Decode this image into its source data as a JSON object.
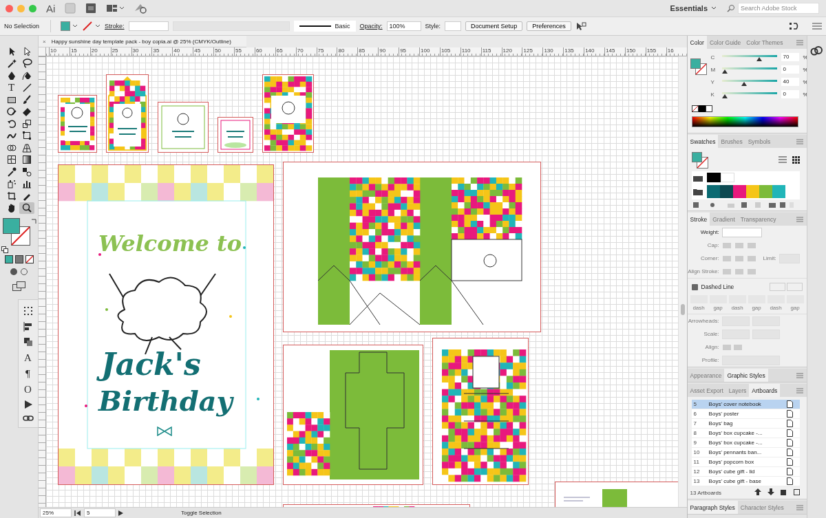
{
  "app_bar": {
    "app_label": "Ai",
    "workspace": "Essentials",
    "search": {
      "placeholder": "Search Adobe Stock"
    }
  },
  "control_bar": {
    "selection": "No Selection",
    "stroke_label": "Stroke:",
    "brush": "Basic",
    "opacity_label": "Opacity:",
    "opacity": "100%",
    "style_label": "Style:",
    "buttons": [
      "Document Setup",
      "Preferences"
    ]
  },
  "document_tab": {
    "close": "×",
    "title": "Happy sunshine day template pack - boy copia.ai @ 25% (CMYK/Outline)"
  },
  "ruler": {
    "labels": [
      "10",
      "15",
      "20",
      "25",
      "30",
      "35",
      "40",
      "45",
      "50",
      "55",
      "60",
      "65",
      "70",
      "75",
      "80",
      "85",
      "90",
      "95",
      "100",
      "105",
      "110",
      "115",
      "120",
      "125",
      "130",
      "135",
      "140",
      "145",
      "150",
      "155",
      "16"
    ]
  },
  "tools": [
    {
      "kind": "selection",
      "selected": false
    },
    {
      "kind": "direct",
      "selected": false
    },
    {
      "kind": "wand",
      "selected": false
    },
    {
      "kind": "lasso",
      "selected": false
    },
    {
      "kind": "pen",
      "selected": false
    },
    {
      "kind": "curvature",
      "selected": false
    },
    {
      "kind": "type",
      "glyph": "T",
      "selected": false
    },
    {
      "kind": "line",
      "selected": false
    },
    {
      "kind": "rectangle",
      "selected": false
    },
    {
      "kind": "brush",
      "selected": false
    },
    {
      "kind": "shaper",
      "selected": false
    },
    {
      "kind": "eraser",
      "selected": false
    },
    {
      "kind": "rotate",
      "selected": false
    },
    {
      "kind": "scale",
      "selected": false
    },
    {
      "kind": "warp",
      "selected": false
    },
    {
      "kind": "transform",
      "selected": false
    },
    {
      "kind": "shape-builder",
      "selected": false
    },
    {
      "kind": "perspective",
      "selected": false
    },
    {
      "kind": "mesh",
      "selected": false
    },
    {
      "kind": "gradient",
      "selected": false
    },
    {
      "kind": "eyedropper",
      "selected": false
    },
    {
      "kind": "blend",
      "selected": false
    },
    {
      "kind": "sprayer",
      "selected": false
    },
    {
      "kind": "graph",
      "selected": false
    },
    {
      "kind": "artboard",
      "selected": false
    },
    {
      "kind": "pencil",
      "selected": false
    },
    {
      "kind": "hand",
      "selected": false
    },
    {
      "kind": "zoom",
      "selected": true
    }
  ],
  "floating_panel": {
    "glyphs": [
      "A",
      "¶",
      "O"
    ]
  },
  "artwork": {
    "welcome": "Welcome to",
    "name": "Jack's",
    "occasion": "Birthday"
  },
  "status_bar": {
    "zoom": "25%",
    "artboard": "5",
    "action": "Toggle Selection"
  },
  "color_panel": {
    "tabs": [
      {
        "label": "Color",
        "selected": true
      },
      {
        "label": "Color Guide",
        "selected": false
      },
      {
        "label": "Color Themes",
        "selected": false
      }
    ],
    "channels": [
      {
        "name": "C",
        "level": 0.7,
        "value": "70",
        "unit": "%"
      },
      {
        "name": "M",
        "level": 0,
        "value": "0",
        "unit": "%"
      },
      {
        "name": "Y",
        "level": 0.4,
        "value": "40",
        "unit": "%"
      },
      {
        "name": "K",
        "level": 0,
        "value": "0",
        "unit": "%"
      }
    ]
  },
  "swatches_panel": {
    "tabs": [
      {
        "label": "Swatches",
        "selected": true
      },
      {
        "label": "Brushes",
        "selected": false
      },
      {
        "label": "Symbols",
        "selected": false
      }
    ],
    "swatches": [
      {
        "color": "#0b6b73"
      },
      {
        "color": "#0d4a52"
      },
      {
        "color": "#e8197d"
      },
      {
        "color": "#f5c518"
      },
      {
        "color": "#7cbb3a"
      },
      {
        "color": "#21b5b8"
      }
    ]
  },
  "stroke_panel": {
    "tabs": [
      {
        "label": "Stroke",
        "selected": true
      },
      {
        "label": "Gradient",
        "selected": false
      },
      {
        "label": "Transparency",
        "selected": false
      }
    ],
    "weight_label": "Weight:",
    "cap_label": "Cap:",
    "corner_label": "Corner:",
    "limit_label": "Limit:",
    "align_label": "Align Stroke:",
    "dashed_line": {
      "label": "Dashed Line",
      "checked": false
    },
    "dash_fields": [
      "dash",
      "gap",
      "dash",
      "gap",
      "dash",
      "gap"
    ],
    "arrowheads_label": "Arrowheads:",
    "scale_label": "Scale:",
    "arrow_align_label": "Align:",
    "profile_label": "Profile:"
  },
  "styles_panel": {
    "tabs": [
      {
        "label": "Appearance",
        "selected": false
      },
      {
        "label": "Graphic Styles",
        "selected": true
      }
    ]
  },
  "artboards_panel": {
    "tabs": [
      {
        "label": "Asset Export",
        "selected": false
      },
      {
        "label": "Layers",
        "selected": false
      },
      {
        "label": "Artboards",
        "selected": true
      }
    ],
    "rows": [
      {
        "number": "5",
        "name": "Boys' cover notebook",
        "selected": true
      },
      {
        "number": "6",
        "name": "Boys' poster",
        "selected": false
      },
      {
        "number": "7",
        "name": "Boys' bag",
        "selected": false
      },
      {
        "number": "8",
        "name": "Boys' box cupcake -...",
        "selected": false
      },
      {
        "number": "9",
        "name": "Boys' box cupcake -...",
        "selected": false
      },
      {
        "number": "10",
        "name": "Boys' pennants ban...",
        "selected": false
      },
      {
        "number": "11",
        "name": "Boys' popcorn box",
        "selected": false
      },
      {
        "number": "12",
        "name": "Boys' cube gift - lid",
        "selected": false
      },
      {
        "number": "13",
        "name": "Boys' cube gift - base",
        "selected": false
      }
    ],
    "count": "13 Artboards"
  },
  "text_styles_panel": {
    "tabs": [
      {
        "label": "Paragraph Styles",
        "selected": true
      },
      {
        "label": "Character Styles",
        "selected": false
      }
    ]
  }
}
